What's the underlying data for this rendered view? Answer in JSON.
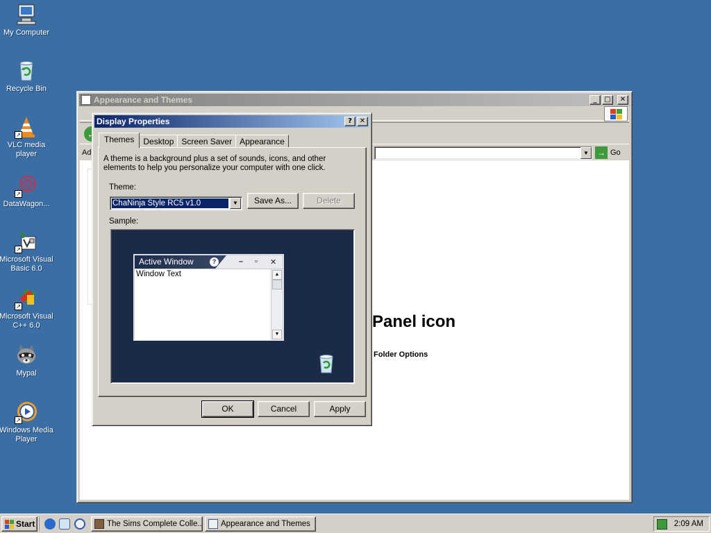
{
  "desktop": {
    "icons": [
      {
        "label": "My Computer",
        "icon": "computer-icon"
      },
      {
        "label": "Recycle Bin",
        "icon": "recycle-bin-icon"
      },
      {
        "label": "VLC media player",
        "icon": "vlc-cone-icon"
      },
      {
        "label": "DataWagon...",
        "icon": "datawagon-icon"
      },
      {
        "label": "Microsoft Visual Basic 6.0",
        "icon": "visual-basic-icon"
      },
      {
        "label": "Microsoft Visual C++ 6.0",
        "icon": "visual-cpp-icon"
      },
      {
        "label": "Mypal",
        "icon": "raccoon-icon"
      },
      {
        "label": "Windows Media Player",
        "icon": "media-player-icon"
      }
    ],
    "background_color": "#3a6ea5"
  },
  "explorer": {
    "title": "Appearance and Themes",
    "address_label": "Add",
    "go_label": "Go",
    "heading": "Panel icon",
    "link": "Folder Options"
  },
  "dialog": {
    "title": "Display Properties",
    "help_button": "?",
    "close_button": "✕",
    "tabs": [
      "Themes",
      "Desktop",
      "Screen Saver",
      "Appearance"
    ],
    "description": "A theme is a background plus a set of sounds, icons, and other elements to help you personalize your computer with one click.",
    "theme_label": "Theme:",
    "theme_value": "ChaNinja Style RC5 v1.0",
    "save_as": "Save As...",
    "delete": "Delete",
    "sample_label": "Sample:",
    "sample": {
      "window_title": "Active Window",
      "window_text": "Window Text"
    },
    "ok": "OK",
    "cancel": "Cancel",
    "apply": "Apply"
  },
  "taskbar": {
    "start": "Start",
    "tasks": [
      {
        "label": "The Sims Complete Colle...",
        "active": false
      },
      {
        "label": "Appearance and Themes",
        "active": false
      }
    ],
    "clock": "2:09 AM"
  }
}
